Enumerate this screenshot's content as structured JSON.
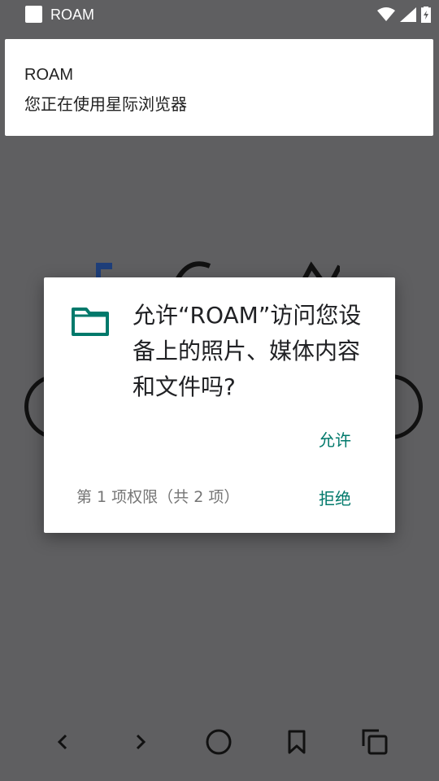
{
  "status_bar": {
    "app_name": "ROAM",
    "icons": [
      "wifi-icon",
      "cell-signal-icon",
      "battery-charging-icon"
    ]
  },
  "notification": {
    "title": "ROAM",
    "text": "您正在使用星际浏览器"
  },
  "permission_dialog": {
    "icon": "folder-icon",
    "question": "允许“ROAM”访问您设备上的照片、媒体内容和文件吗?",
    "allow_label": "允许",
    "deny_label": "拒绝",
    "permission_count": "第 1 项权限（共 2 项）",
    "accent_color": "#00796b"
  },
  "bottom_nav": {
    "items": [
      "back-icon",
      "forward-icon",
      "home-icon",
      "bookmark-icon",
      "tabs-icon"
    ]
  }
}
